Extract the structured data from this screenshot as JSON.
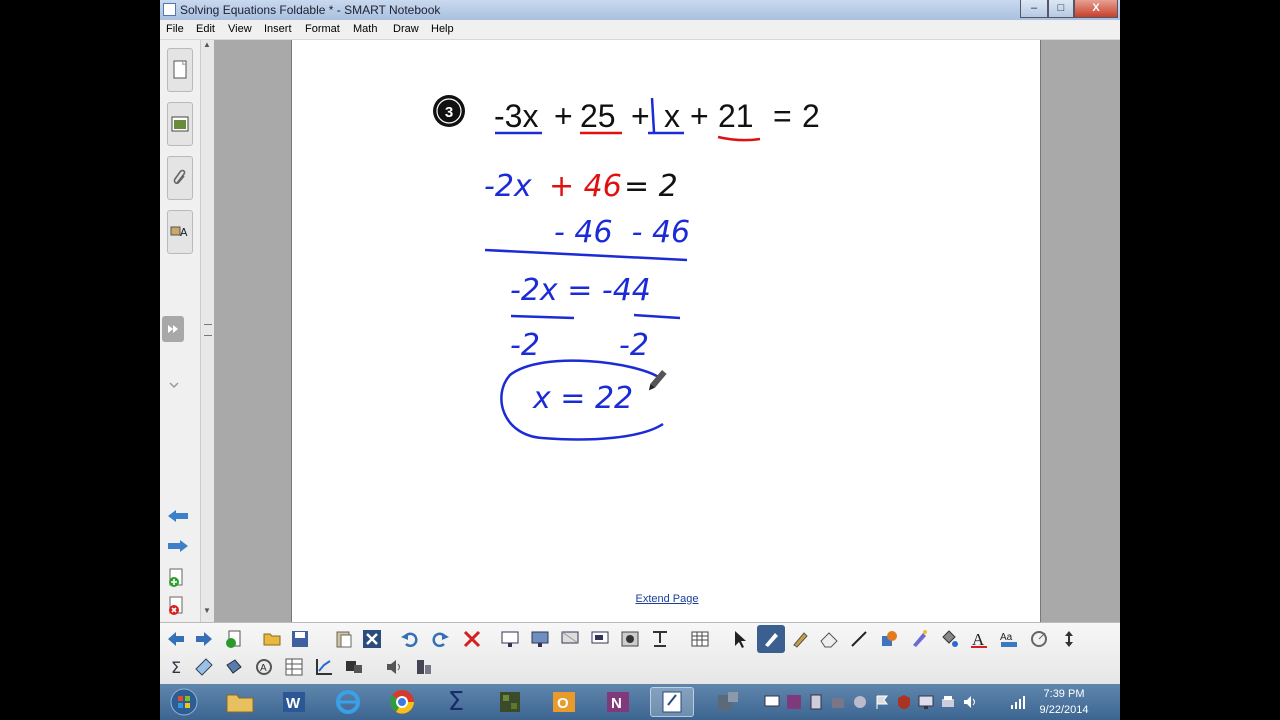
{
  "window": {
    "title": "Solving Equations Foldable * - SMART Notebook",
    "min_label": "–",
    "max_label": "□",
    "close_label": "X"
  },
  "menu": [
    "File",
    "Edit",
    "View",
    "Insert",
    "Format",
    "Math",
    "Draw",
    "Help"
  ],
  "page": {
    "problem_number": "3",
    "equation_terms": [
      "-3x",
      "+",
      "25",
      "+",
      "x",
      "+",
      "21",
      "=",
      "2"
    ],
    "work": {
      "line1_left": "-2x",
      "line1_mid": "+ 46",
      "line1_right": "= 2",
      "line2": "- 46  - 46",
      "line3": "-2x = -44",
      "line4_left": "-2",
      "line4_right": "-2",
      "answer": "x = 22"
    },
    "extend_page": "Extend Page"
  },
  "toolbar": {
    "row1": [
      "previous-page",
      "next-page",
      "add-page",
      "open-file",
      "save-file",
      "paste",
      "delete",
      "undo",
      "redo",
      "clear",
      "screen-shade",
      "full-screen",
      "dual-view",
      "capture",
      "gallery",
      "table",
      "select",
      "pen",
      "creative-pen",
      "eraser",
      "line",
      "shapes",
      "magic-pen",
      "fill",
      "text",
      "properties",
      "measure",
      "more"
    ],
    "row2": [
      "sum",
      "ruler",
      "compass",
      "math-tools",
      "document-camera",
      "graph",
      "keyboard",
      "sound",
      "geometry"
    ]
  },
  "taskbar": {
    "apps": [
      "start",
      "explorer",
      "word",
      "internet-explorer",
      "chrome",
      "smart-math",
      "game",
      "outlook",
      "onenote",
      "smart-notebook",
      "tools"
    ],
    "time": "7:39 PM",
    "date": "9/22/2014"
  },
  "colors": {
    "ink_blue": "#1b2bd6",
    "ink_red": "#e01010",
    "ink_black": "#111111"
  }
}
